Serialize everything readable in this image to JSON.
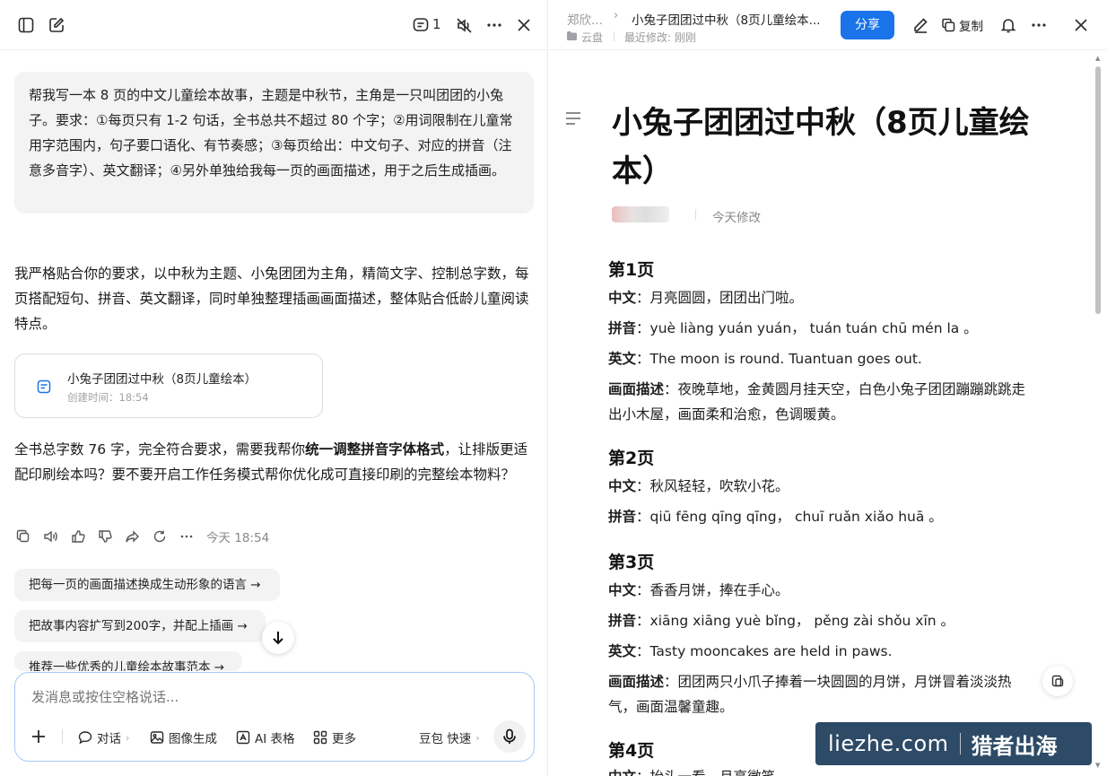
{
  "left_header": {
    "comment_count": "1"
  },
  "user_message": "帮我写一本 8 页的中文儿童绘本故事，主题是中秋节，主角是一只叫团团的小兔子。要求：①每页只有 1-2 句话，全书总共不超过 80 个字；②用词限制在儿童常用字范围内，句子要口语化、有节奏感；③每页给出：中文句子、对应的拼音（注意多音字）、英文翻译；④另外单独给我每一页的画面描述，用于之后生成插画。",
  "reply_intro": "我严格贴合你的要求，以中秋为主题、小兔团团为主角，精简文字、控制总字数，每页搭配短句、拼音、英文翻译，同时单独整理插画画面描述，整体贴合低龄儿童阅读特点。",
  "doc_card": {
    "title": "小兔子团团过中秋（8页儿童绘本）",
    "created": "创建时间：18:54"
  },
  "reply_outro": {
    "part1": "全书总字数 76 字，完全符合要求，需要我帮你",
    "bold": "统一调整拼音字体格式",
    "part2": "，让排版更适配印刷绘本吗？要不要开启工作任务模式帮你优化成可直接印刷的完整绘本物料？"
  },
  "timestamp": "今天 18:54",
  "suggestions": [
    "把每一页的画面描述换成生动形象的语言 →",
    "把故事内容扩写到200字，并配上插画 →",
    "推荐一些优秀的儿童绘本故事范本 →"
  ],
  "input": {
    "placeholder": "发消息或按住空格说话..."
  },
  "toolbar": {
    "chat": "对话",
    "image": "图像生成",
    "table": "AI 表格",
    "more": "更多",
    "model": "豆包 快速"
  },
  "right_header": {
    "crumb_parent": "郑欣...",
    "crumb_title": "小兔子团团过中秋（8页儿童绘本...",
    "location": "云盘",
    "modified": "最近修改: 刚刚",
    "share": "分享",
    "copy": "复制"
  },
  "doc": {
    "title": "小兔子团团过中秋（8页儿童绘本）",
    "modified": "今天修改",
    "pages": [
      {
        "heading": "第1页",
        "lines": [
          {
            "label": "中文",
            "text": "：月亮圆圆，团团出门啦。"
          },
          {
            "label": "拼音",
            "text": "：yuè liàng yuán yuán， tuán tuán chū mén la 。"
          },
          {
            "label": "英文",
            "text": "：The moon is round. Tuantuan goes out."
          },
          {
            "label": "画面描述",
            "text": "：夜晚草地，金黄圆月挂天空，白色小兔子团团蹦蹦跳跳走出小木屋，画面柔和治愈，色调暖黄。"
          }
        ]
      },
      {
        "heading": "第2页",
        "lines": [
          {
            "label": "中文",
            "text": "：秋风轻轻，吹软小花。"
          },
          {
            "label": "拼音",
            "text": "：qiū fēng qīng qīng， chuī ruǎn xiǎo huā 。"
          }
        ]
      },
      {
        "heading": "第3页",
        "lines": [
          {
            "label": "中文",
            "text": "：香香月饼，捧在手心。"
          },
          {
            "label": "拼音",
            "text": "：xiāng xiāng yuè bǐng， pěng zài shǒu xīn 。"
          },
          {
            "label": "英文",
            "text": "：Tasty mooncakes are held in paws."
          },
          {
            "label": "画面描述",
            "text": "：团团两只小爪子捧着一块圆圆的月饼，月饼冒着淡淡热气，画面温馨童趣。"
          }
        ]
      },
      {
        "heading": "第4页",
        "lines": [
          {
            "label": "中文",
            "text": "：抬头一看，月亮微笑。"
          }
        ]
      }
    ]
  },
  "watermark": {
    "site": "liezhe.com",
    "brand": "猎者出海"
  },
  "colors": {
    "accent": "#1a73e8",
    "input_border": "#a7c5f7",
    "bubble": "#f3f3f4",
    "watermark": "#2d4a66"
  }
}
